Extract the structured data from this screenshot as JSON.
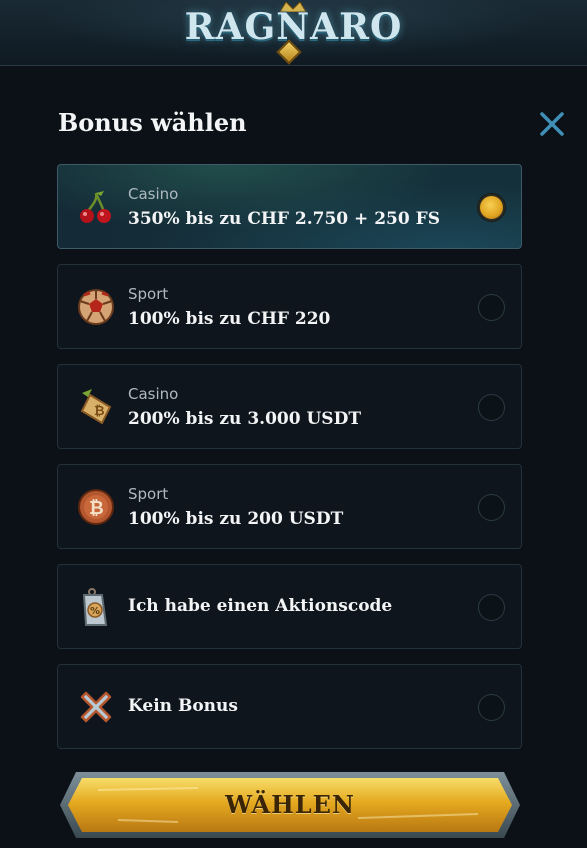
{
  "header": {
    "logo_text": "RAGNARO"
  },
  "dialog": {
    "title": "Bonus wählen",
    "close_icon": "close-icon",
    "options": [
      {
        "category": "Casino",
        "text": "350% bis zu CHF 2.750 + 250 FS",
        "icon": "cherries-icon",
        "selected": true
      },
      {
        "category": "Sport",
        "text": "100% bis zu CHF 220",
        "icon": "soccer-ball-icon",
        "selected": false
      },
      {
        "category": "Casino",
        "text": "200% bis zu 3.000 USDT",
        "icon": "bitcoin-tag-icon",
        "selected": false
      },
      {
        "category": "Sport",
        "text": "100% bis zu 200 USDT",
        "icon": "bitcoin-coin-icon",
        "selected": false
      },
      {
        "category": "",
        "text": "Ich habe einen Aktionscode",
        "icon": "promo-tag-icon",
        "selected": false
      },
      {
        "category": "",
        "text": "Kein Bonus",
        "icon": "no-bonus-x-icon",
        "selected": false
      }
    ],
    "submit_label": "WÄHLEN"
  },
  "colors": {
    "background": "#0b1117",
    "accent_gold": "#e2a623",
    "selected_bg": "#15303a"
  }
}
